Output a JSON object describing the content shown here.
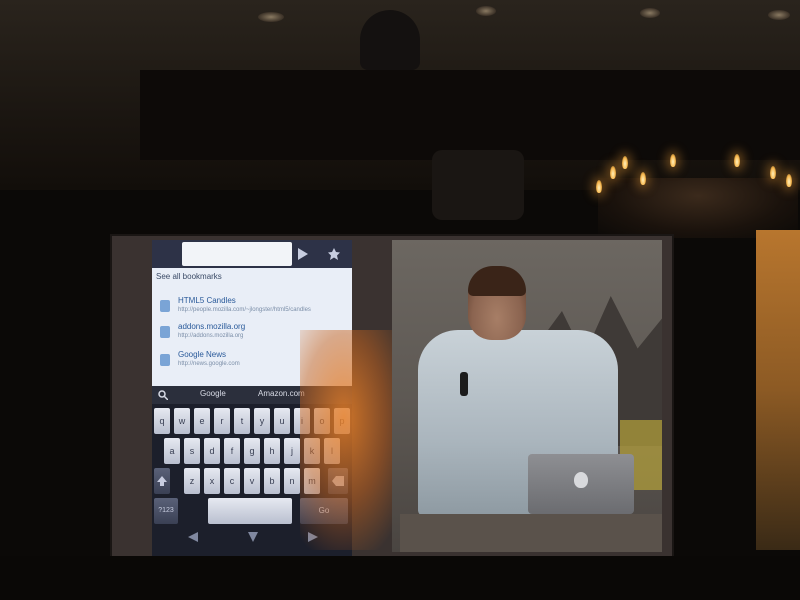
{
  "phone": {
    "bookmarks_header": "See all bookmarks",
    "bookmarks": [
      {
        "title": "HTML5 Candles",
        "url": "http://people.mozilla.com/~jlongster/html5/candles"
      },
      {
        "title": "addons.mozilla.org",
        "url": "http://addons.mozilla.org"
      },
      {
        "title": "Google News",
        "url": "http://news.google.com"
      }
    ],
    "search_engines": [
      "Google",
      "Amazon.com"
    ],
    "keyboard_rows": [
      [
        "q",
        "w",
        "e",
        "r",
        "t",
        "y",
        "u",
        "i",
        "o",
        "p"
      ],
      [
        "a",
        "s",
        "d",
        "f",
        "g",
        "h",
        "j",
        "k",
        "l"
      ],
      [
        "z",
        "x",
        "c",
        "v",
        "b",
        "n",
        "m"
      ]
    ],
    "keyboard_bottom": {
      "left": "?123",
      "space": "",
      "right": "Go"
    }
  },
  "colors": {
    "accent_orange": "#e88028",
    "phone_bg": "#171a24",
    "bookmark_link": "#2a5a9a",
    "shirt": "#c9d2d8"
  }
}
